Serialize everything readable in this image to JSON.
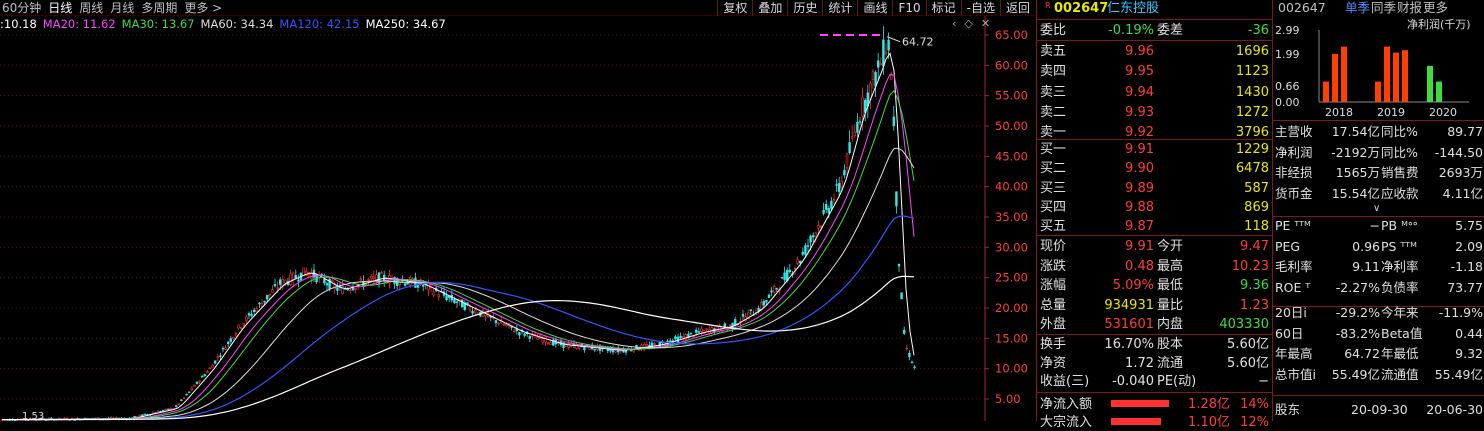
{
  "period_tabs": [
    "60分钟",
    "日线",
    "周线",
    "月线",
    "多周期",
    "更多 >"
  ],
  "active_period": 1,
  "tool_tabs": [
    "复权",
    "叠加",
    "历史",
    "统计",
    "画线",
    "F10",
    "标记",
    "-自选",
    "返回"
  ],
  "ma": [
    {
      "label": ":10.18",
      "color": "#ffffff"
    },
    {
      "label": "MA20: 11.62",
      "color": "#ff44ff"
    },
    {
      "label": "MA30: 13.67",
      "color": "#3fdc3f"
    },
    {
      "label": "MA60: 34.34",
      "color": "#dddddd"
    },
    {
      "label": "MA120: 42.15",
      "color": "#3355ff"
    },
    {
      "label": "MA250: 34.67",
      "color": "#ffffff"
    }
  ],
  "ctrl_icons": [
    "‹",
    "◇",
    "✕"
  ],
  "chart": {
    "y_ticks": [
      "65.00",
      "60.00",
      "55.00",
      "50.00",
      "45.00",
      "40.00",
      "35.00",
      "30.00",
      "25.00",
      "20.00",
      "15.00",
      "10.00",
      "5.00"
    ],
    "high_label": "64.72",
    "low_label": "1.53"
  },
  "quote": {
    "badge": "R",
    "code": "002647",
    "name": "仁东控股",
    "weibi_label": "委比",
    "weibi": "-0.19%",
    "weicha_label": "委差",
    "weicha": "-36",
    "asks": [
      {
        "label": "卖五",
        "price": "9.96",
        "vol": "1696"
      },
      {
        "label": "卖四",
        "price": "9.95",
        "vol": "1123"
      },
      {
        "label": "卖三",
        "price": "9.94",
        "vol": "1430"
      },
      {
        "label": "卖二",
        "price": "9.93",
        "vol": "1272"
      },
      {
        "label": "卖一",
        "price": "9.92",
        "vol": "3796"
      }
    ],
    "bids": [
      {
        "label": "买一",
        "price": "9.91",
        "vol": "1229"
      },
      {
        "label": "买二",
        "price": "9.90",
        "vol": "6478"
      },
      {
        "label": "买三",
        "price": "9.89",
        "vol": "587"
      },
      {
        "label": "买四",
        "price": "9.88",
        "vol": "869"
      },
      {
        "label": "买五",
        "price": "9.87",
        "vol": "118"
      }
    ],
    "stats": [
      {
        "l1": "现价",
        "v1": "9.91",
        "c1": "red",
        "l2": "今开",
        "v2": "9.47",
        "c2": "red"
      },
      {
        "l1": "涨跌",
        "v1": "0.48",
        "c1": "red",
        "l2": "最高",
        "v2": "10.23",
        "c2": "red"
      },
      {
        "l1": "涨幅",
        "v1": "5.09%",
        "c1": "red",
        "l2": "最低",
        "v2": "9.36",
        "c2": "green"
      },
      {
        "l1": "总量",
        "v1": "934931",
        "c1": "yel",
        "l2": "量比",
        "v2": "1.23",
        "c2": "red"
      },
      {
        "l1": "外盘",
        "v1": "531601",
        "c1": "red",
        "l2": "内盘",
        "v2": "403330",
        "c2": "green"
      }
    ],
    "stats2": [
      {
        "l1": "换手",
        "v1": "16.70%",
        "l2": "股本",
        "v2": "5.60亿"
      },
      {
        "l1": "净资",
        "v1": "1.72",
        "l2": "流通",
        "v2": "5.60亿"
      },
      {
        "l1": "收益(三)",
        "v1": "-0.040",
        "l2": "PE(动)",
        "v2": "−"
      }
    ],
    "flow_label": "净流入额",
    "flow_value": "1.28亿",
    "flow_pct": "14%",
    "flow2_label": "大宗流入",
    "flow2_value": "1.10亿",
    "flow2_pct": "12%"
  },
  "fund": {
    "code": "002647",
    "tabs": [
      "单季",
      "同季",
      "财报",
      "更多"
    ],
    "chart_title": "净利润(千万)",
    "chart_data": {
      "type": "bar",
      "categories": [
        "2018",
        "2019",
        "2020"
      ],
      "yticks": [
        "2.99",
        "1.99",
        "0.66",
        "0.00"
      ],
      "ylim": [
        0,
        2.99
      ],
      "series": [
        {
          "values": [
            0.85,
            2.0,
            2.3
          ],
          "color": "#ff4000"
        },
        {
          "values": [
            0.85,
            2.3,
            2.05,
            2.15
          ],
          "color": "#ff4000"
        },
        {
          "values": [
            1.5,
            0.85
          ],
          "color": "#3fdc3f"
        }
      ]
    },
    "rows": [
      {
        "l1": "主营收",
        "v1": "17.54亿",
        "l2": "同比%",
        "v2": "89.77"
      },
      {
        "l1": "净利润",
        "v1": "-2192万",
        "l2": "同比%",
        "v2": "-144.50"
      },
      {
        "l1": "非经损",
        "v1": "1565万",
        "l2": "销售费",
        "v2": "2693万"
      },
      {
        "l1": "货币金",
        "v1": "15.54亿",
        "l2": "应收款",
        "v2": "4.11亿"
      }
    ],
    "rows2": [
      {
        "l1": "PE ᵀᵀᴹ",
        "v1": "−",
        "l2": "PB ᴹᐤᐤ",
        "v2": "5.75"
      },
      {
        "l1": "PEG",
        "v1": "0.96",
        "l2": "PS ᵀᵀᴹ",
        "v2": "2.09"
      },
      {
        "l1": "毛利率",
        "v1": "9.11",
        "l2": "净利率",
        "v2": "-1.18"
      },
      {
        "l1": "ROE ᵀ",
        "v1": "-2.27%",
        "l2": "负债率",
        "v2": "73.77"
      }
    ],
    "rows3": [
      {
        "l1": "20日i",
        "v1": "-29.2%",
        "l2": "今年来",
        "v2": "-11.9%"
      },
      {
        "l1": "60日",
        "v1": "-83.2%",
        "l2": "Beta值",
        "v2": "0.44"
      },
      {
        "l1": "年最高",
        "v1": "64.72",
        "l2": "年最低",
        "v2": "9.32"
      },
      {
        "l1": "总市值i",
        "v1": "55.49亿",
        "l2": "流通值",
        "v2": "55.49亿"
      }
    ],
    "holder_label": "股东",
    "holder_d1": "20-09-30",
    "holder_d2": "20-06-30"
  }
}
